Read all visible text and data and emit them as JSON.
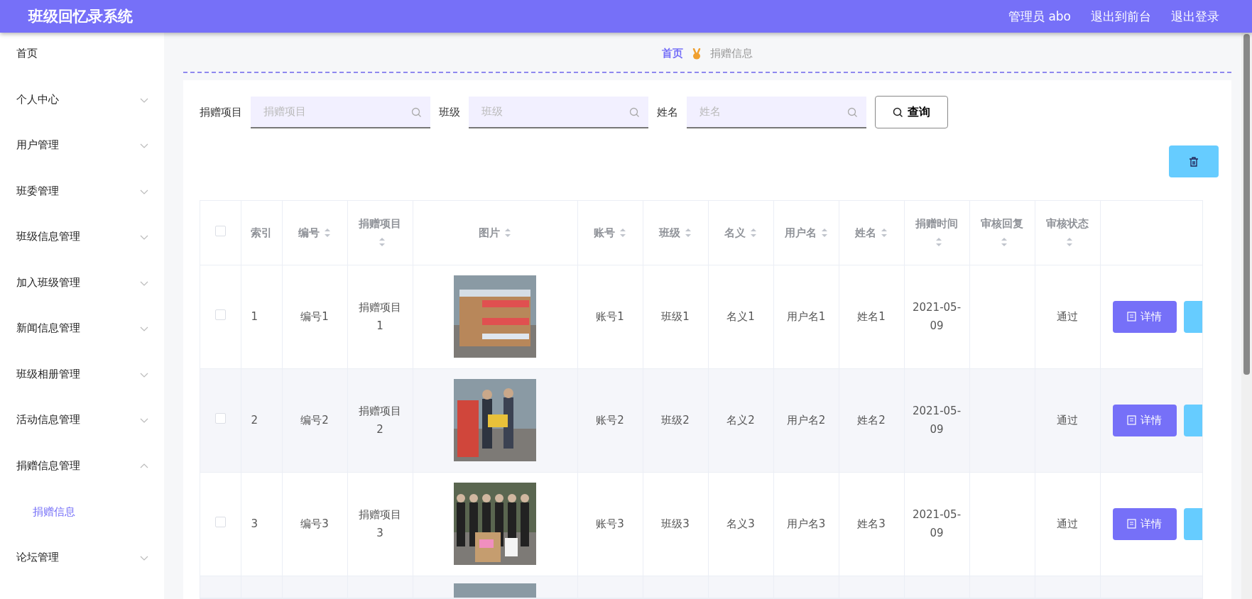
{
  "header": {
    "title": "班级回忆录系统",
    "links": [
      {
        "label": "管理员 abo"
      },
      {
        "label": "退出到前台"
      },
      {
        "label": "退出登录"
      }
    ]
  },
  "sidebar": {
    "items": [
      {
        "label": "首页",
        "kind": "link"
      },
      {
        "label": "个人中心",
        "kind": "group",
        "expanded": false
      },
      {
        "label": "用户管理",
        "kind": "group",
        "expanded": false
      },
      {
        "label": "班委管理",
        "kind": "group",
        "expanded": false
      },
      {
        "label": "班级信息管理",
        "kind": "group",
        "expanded": false
      },
      {
        "label": "加入班级管理",
        "kind": "group",
        "expanded": false
      },
      {
        "label": "新闻信息管理",
        "kind": "group",
        "expanded": false
      },
      {
        "label": "班级相册管理",
        "kind": "group",
        "expanded": false
      },
      {
        "label": "活动信息管理",
        "kind": "group",
        "expanded": false
      },
      {
        "label": "捐赠信息管理",
        "kind": "group",
        "expanded": true,
        "children": [
          {
            "label": "捐赠信息",
            "selected": true
          }
        ]
      },
      {
        "label": "论坛管理",
        "kind": "group",
        "expanded": false
      }
    ]
  },
  "breadcrumb": {
    "items": [
      {
        "label": "首页",
        "selected": true
      },
      {
        "label": "捐赠信息",
        "selected": false
      }
    ]
  },
  "search": {
    "fields": [
      {
        "label": "捐赠项目",
        "placeholder": "捐赠项目"
      },
      {
        "label": "班级",
        "placeholder": "班级"
      },
      {
        "label": "姓名",
        "placeholder": "姓名"
      }
    ],
    "button": "查询"
  },
  "table": {
    "select_all": {
      "checked": false
    },
    "columns": [
      {
        "label": "索引",
        "kind": "plain"
      },
      {
        "label": "编号",
        "kind": "sortable"
      },
      {
        "label": "捐赠项目",
        "kind": "sortable"
      },
      {
        "label": "图片",
        "kind": "sortable"
      },
      {
        "label": "账号",
        "kind": "sortable"
      },
      {
        "label": "班级",
        "kind": "sortable"
      },
      {
        "label": "名义",
        "kind": "sortable"
      },
      {
        "label": "用户名",
        "kind": "sortable"
      },
      {
        "label": "姓名",
        "kind": "sortable"
      },
      {
        "label": "捐赠时间",
        "kind": "sortable"
      },
      {
        "label": "审核回复",
        "kind": "sortable"
      },
      {
        "label": "审核状态",
        "kind": "sortable"
      }
    ],
    "rows": [
      {
        "checked": false,
        "index": "1",
        "code": "编号1",
        "project": "捐赠项目1",
        "account": "账号1",
        "class": "班级1",
        "title": "名义1",
        "username": "用户名1",
        "name": "姓名1",
        "time": "2021-05-09",
        "status": "通过",
        "detail_button": "详情"
      },
      {
        "checked": false,
        "index": "2",
        "code": "编号2",
        "project": "捐赠项目2",
        "account": "账号2",
        "class": "班级2",
        "title": "名义2",
        "username": "用户名2",
        "name": "姓名2",
        "time": "2021-05-09",
        "status": "通过",
        "detail_button": "详情"
      },
      {
        "checked": false,
        "index": "3",
        "code": "编号3",
        "project": "捐赠项目3",
        "account": "账号3",
        "class": "班级3",
        "title": "名义3",
        "username": "用户名3",
        "name": "姓名3",
        "time": "2021-05-09",
        "status": "通过",
        "detail_button": "详情"
      }
    ]
  }
}
